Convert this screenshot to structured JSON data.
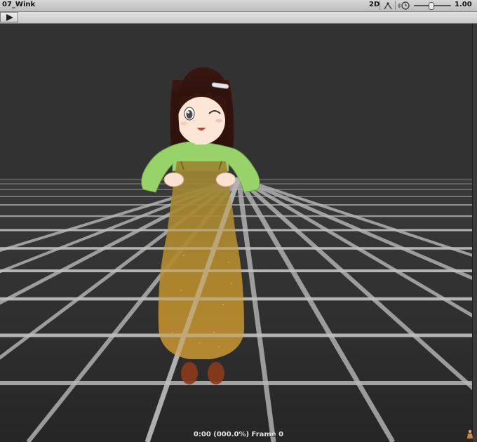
{
  "window": {
    "title": "07_Wink"
  },
  "toolbar": {
    "mode_label": "2D",
    "playback_speed": "1.00",
    "speed_slider_level": 0.45,
    "play_icon": "play-icon"
  },
  "status": {
    "frame_text": "0:00 (000.0%) Frame 0"
  },
  "colors": {
    "viewport_bg": "#323232",
    "grid_line": "#bdbdbd",
    "sweater": "#98d36a",
    "dress": "#a8862d",
    "hair": "#3b1a12"
  }
}
